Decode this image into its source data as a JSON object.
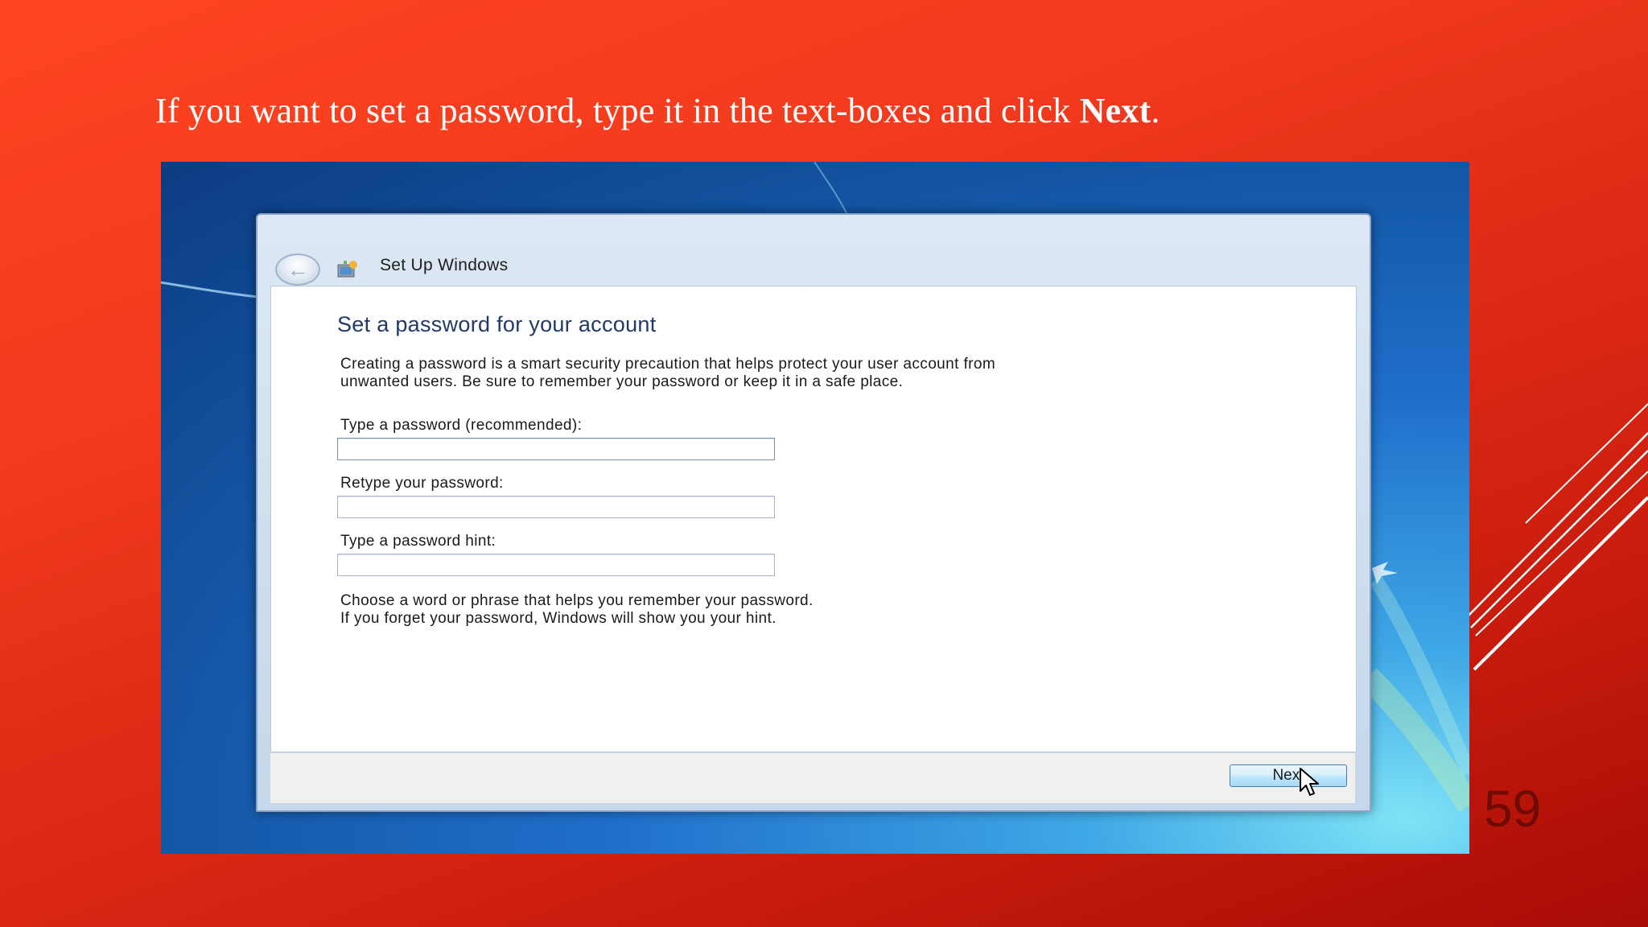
{
  "slide": {
    "instruction_prefix": "If you want to set a password, type it in the text-boxes and click ",
    "instruction_bold": "Next",
    "instruction_suffix": ".",
    "page_number": "59"
  },
  "window": {
    "title": "Set Up Windows",
    "heading": "Set a password for your account",
    "description_line1": "Creating a password is a smart security precaution that helps protect your user account from",
    "description_line2": "unwanted users. Be sure to remember your password or keep it in a safe place.",
    "password_label": "Type a password (recommended):",
    "password_value": "",
    "retype_label": "Retype your password:",
    "retype_value": "",
    "hint_label": "Type a password hint:",
    "hint_value": "",
    "note_line1": "Choose a word or phrase that helps you remember your password.",
    "note_line2": "If you forget your password, Windows will show you your hint.",
    "next_label": "Next"
  },
  "icons": {
    "back": "back-arrow-icon",
    "setup": "setup-windows-icon",
    "cursor": "mouse-pointer-icon"
  },
  "colors": {
    "slide_background": "#f23a1e",
    "page_number": "#6e0b04",
    "heading": "#1f3a66",
    "button_border": "#3c7fb1"
  }
}
